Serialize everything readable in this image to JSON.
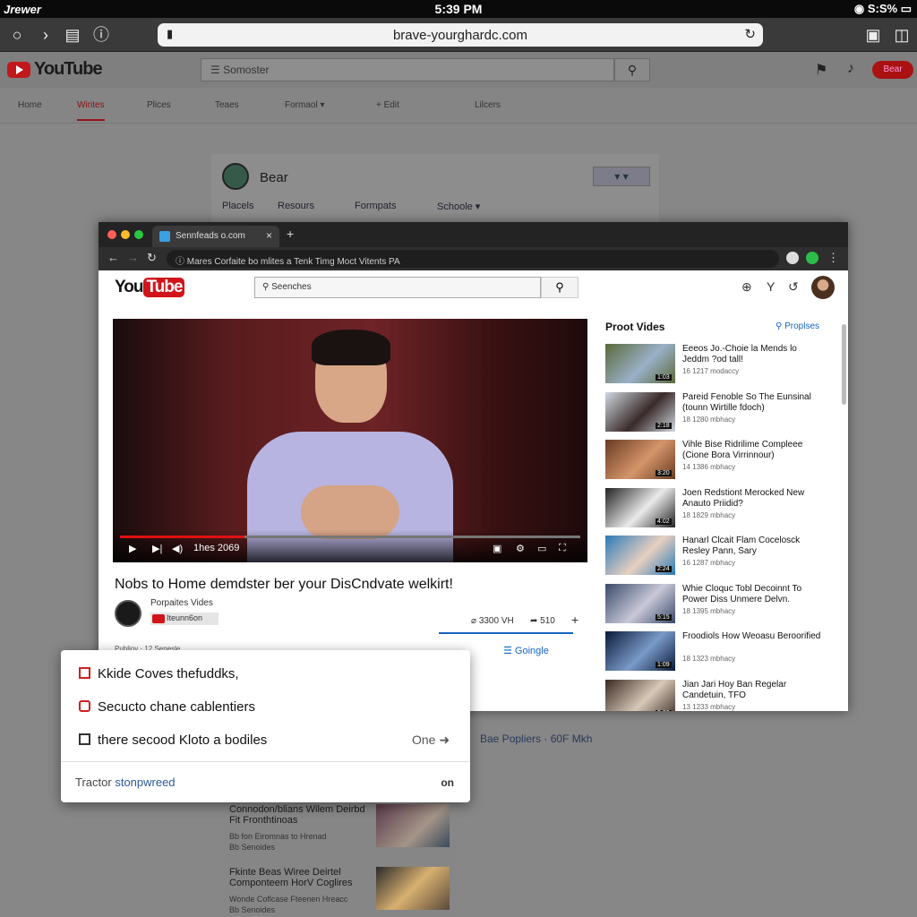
{
  "status": {
    "carrier": "Jrewer",
    "time": "5:39 PM",
    "battery": "S:S%"
  },
  "browser": {
    "url": "brave-yourghardc.com"
  },
  "outer_yt": {
    "logo": "YouTube",
    "search_placeholder": "Somoster",
    "signin": "Bear",
    "nav": [
      "Home",
      "Wirites",
      "Plices",
      "Teaes",
      "Formaol ▾",
      "+ Edit",
      "Lilcers"
    ],
    "channel": {
      "name": "Bear",
      "tabs": [
        "Placels",
        "Resours",
        "Formpats",
        "Schoole ▾"
      ]
    },
    "list": [
      {
        "title": "Connodon/blians Wilem Deirbd Fit Fronthtinoas",
        "meta": "Bb fon Eiromnas to Hrenad\nBb Senoides"
      },
      {
        "title": "Fkinte Beas Wiree Deirtel Componteem HorV Coglires",
        "meta": "Wonde Coflcase Fteenen Hreacc\nBb Senoides"
      }
    ],
    "bg_popliers": "Bae Popliers · 60F Mkh"
  },
  "window": {
    "tab_title": "Sennfeads o.com",
    "address": "Mares Corfaite bo mlites a Tenk Timg Moct Vitents PA",
    "yt_logo_you": "You",
    "yt_logo_tube": "Tube",
    "search_placeholder": "Seenches",
    "video": {
      "time": "1hes 2069",
      "title": "Nobs to Home demdster ber your DisCndvate welkirt!",
      "channel": "Porpaites Vides",
      "sub": "Iteunn6on",
      "views": "3300 VH",
      "shares": "510",
      "meta": "Publioy · 12 Senesle",
      "google": "Goingle"
    },
    "sidebar": {
      "header": "Proot Vides",
      "more": "Proplses",
      "items": [
        {
          "title": "Eeeos Jo.-Choie la Mends lo Jeddm ?od tall!",
          "meta": "16 1217 modaccy",
          "dur": "1:03",
          "c1": "#5a6a3a",
          "c2": "#9ab0c8"
        },
        {
          "title": "Pareid Fenoble So The Eunsinal (tounn Wirtille fdoch)",
          "meta": "18 1280 mbhacy",
          "dur": "2:18",
          "c1": "#cfd8e0",
          "c2": "#3a2a2a"
        },
        {
          "title": "Vihle Bise Ridrilime Compleee (Cione Bora Virrinnour)",
          "meta": "14 1386 mbhacy",
          "dur": "3:20",
          "c1": "#6a3a22",
          "c2": "#d4956a"
        },
        {
          "title": "Joen Redstiont Merocked New Anauto Priidid?",
          "meta": "18 1829 mbhacy",
          "dur": "4:02",
          "c1": "#222",
          "c2": "#eaeaea"
        },
        {
          "title": "Hanarl Clcait Flam Cocelosck Resley Pann, Sary",
          "meta": "16 1287 mbhacy",
          "dur": "2:24",
          "c1": "#2a7ab8",
          "c2": "#e8d0c0"
        },
        {
          "title": "Whie Cloquc Tobl Decoinnt To Power Diss Unmere Delvn.",
          "meta": "18 1395 mbhacy",
          "dur": "5:15",
          "c1": "#3a4a6a",
          "c2": "#c8c8d8"
        },
        {
          "title": "Froodiols How Weoasu Beroorified",
          "meta": "18 1323 mbhacy",
          "dur": "1:09",
          "c1": "#0a1a3a",
          "c2": "#7a9ac8"
        },
        {
          "title": "Jian Jari Hoy Ban Regelar Candetuin, TFO",
          "meta": "13 1233 mbhacy",
          "dur": "3:33",
          "c1": "#3a2a22",
          "c2": "#d8c8b8"
        }
      ]
    }
  },
  "popup": {
    "items": [
      "Kkide Coves thefuddks,",
      "Secucto chane cablentiers",
      "there secood Kloto a bodiles"
    ],
    "one": "One ➜",
    "footer_a": "Tractor",
    "footer_b": "stonpwreed",
    "on": "on"
  },
  "colors": {
    "brand_red": "#d0141a",
    "link_blue": "#1565c0"
  }
}
